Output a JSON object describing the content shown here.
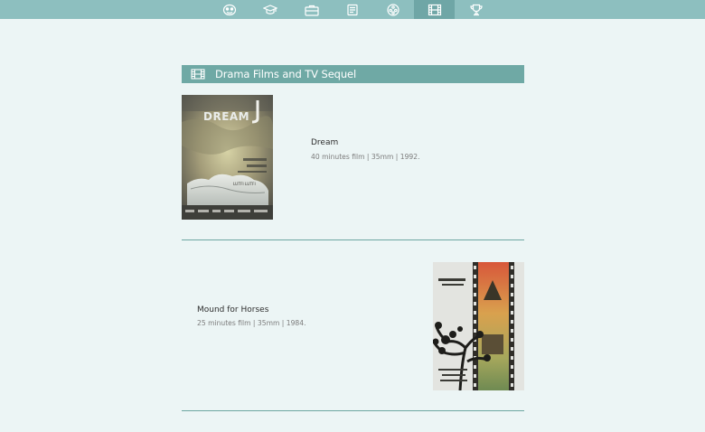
{
  "nav": {
    "items": [
      {
        "icon": "mask-icon",
        "label": ""
      },
      {
        "icon": "graduation-cap-icon",
        "label": ""
      },
      {
        "icon": "briefcase-icon",
        "label": ""
      },
      {
        "icon": "book-icon",
        "label": ""
      },
      {
        "icon": "film-reel-icon",
        "label": ""
      },
      {
        "icon": "film-strip-icon",
        "label": "",
        "active": true
      },
      {
        "icon": "trophy-icon",
        "label": ""
      }
    ],
    "color": "#8dbfbf",
    "active_color": "#6fa6a6"
  },
  "section": {
    "title": "Drama Films and TV Sequel",
    "icon": "film-strip-icon",
    "color": "#6fa9a5"
  },
  "films": [
    {
      "title": "Dream",
      "meta": "40 minutes film | 35mm | 1992.",
      "poster_text": "DREAM",
      "poster_credit": "LUTFI LUTFI"
    },
    {
      "title": "Mound for Horses",
      "meta": "25 minutes film | 35mm | 1984."
    }
  ]
}
